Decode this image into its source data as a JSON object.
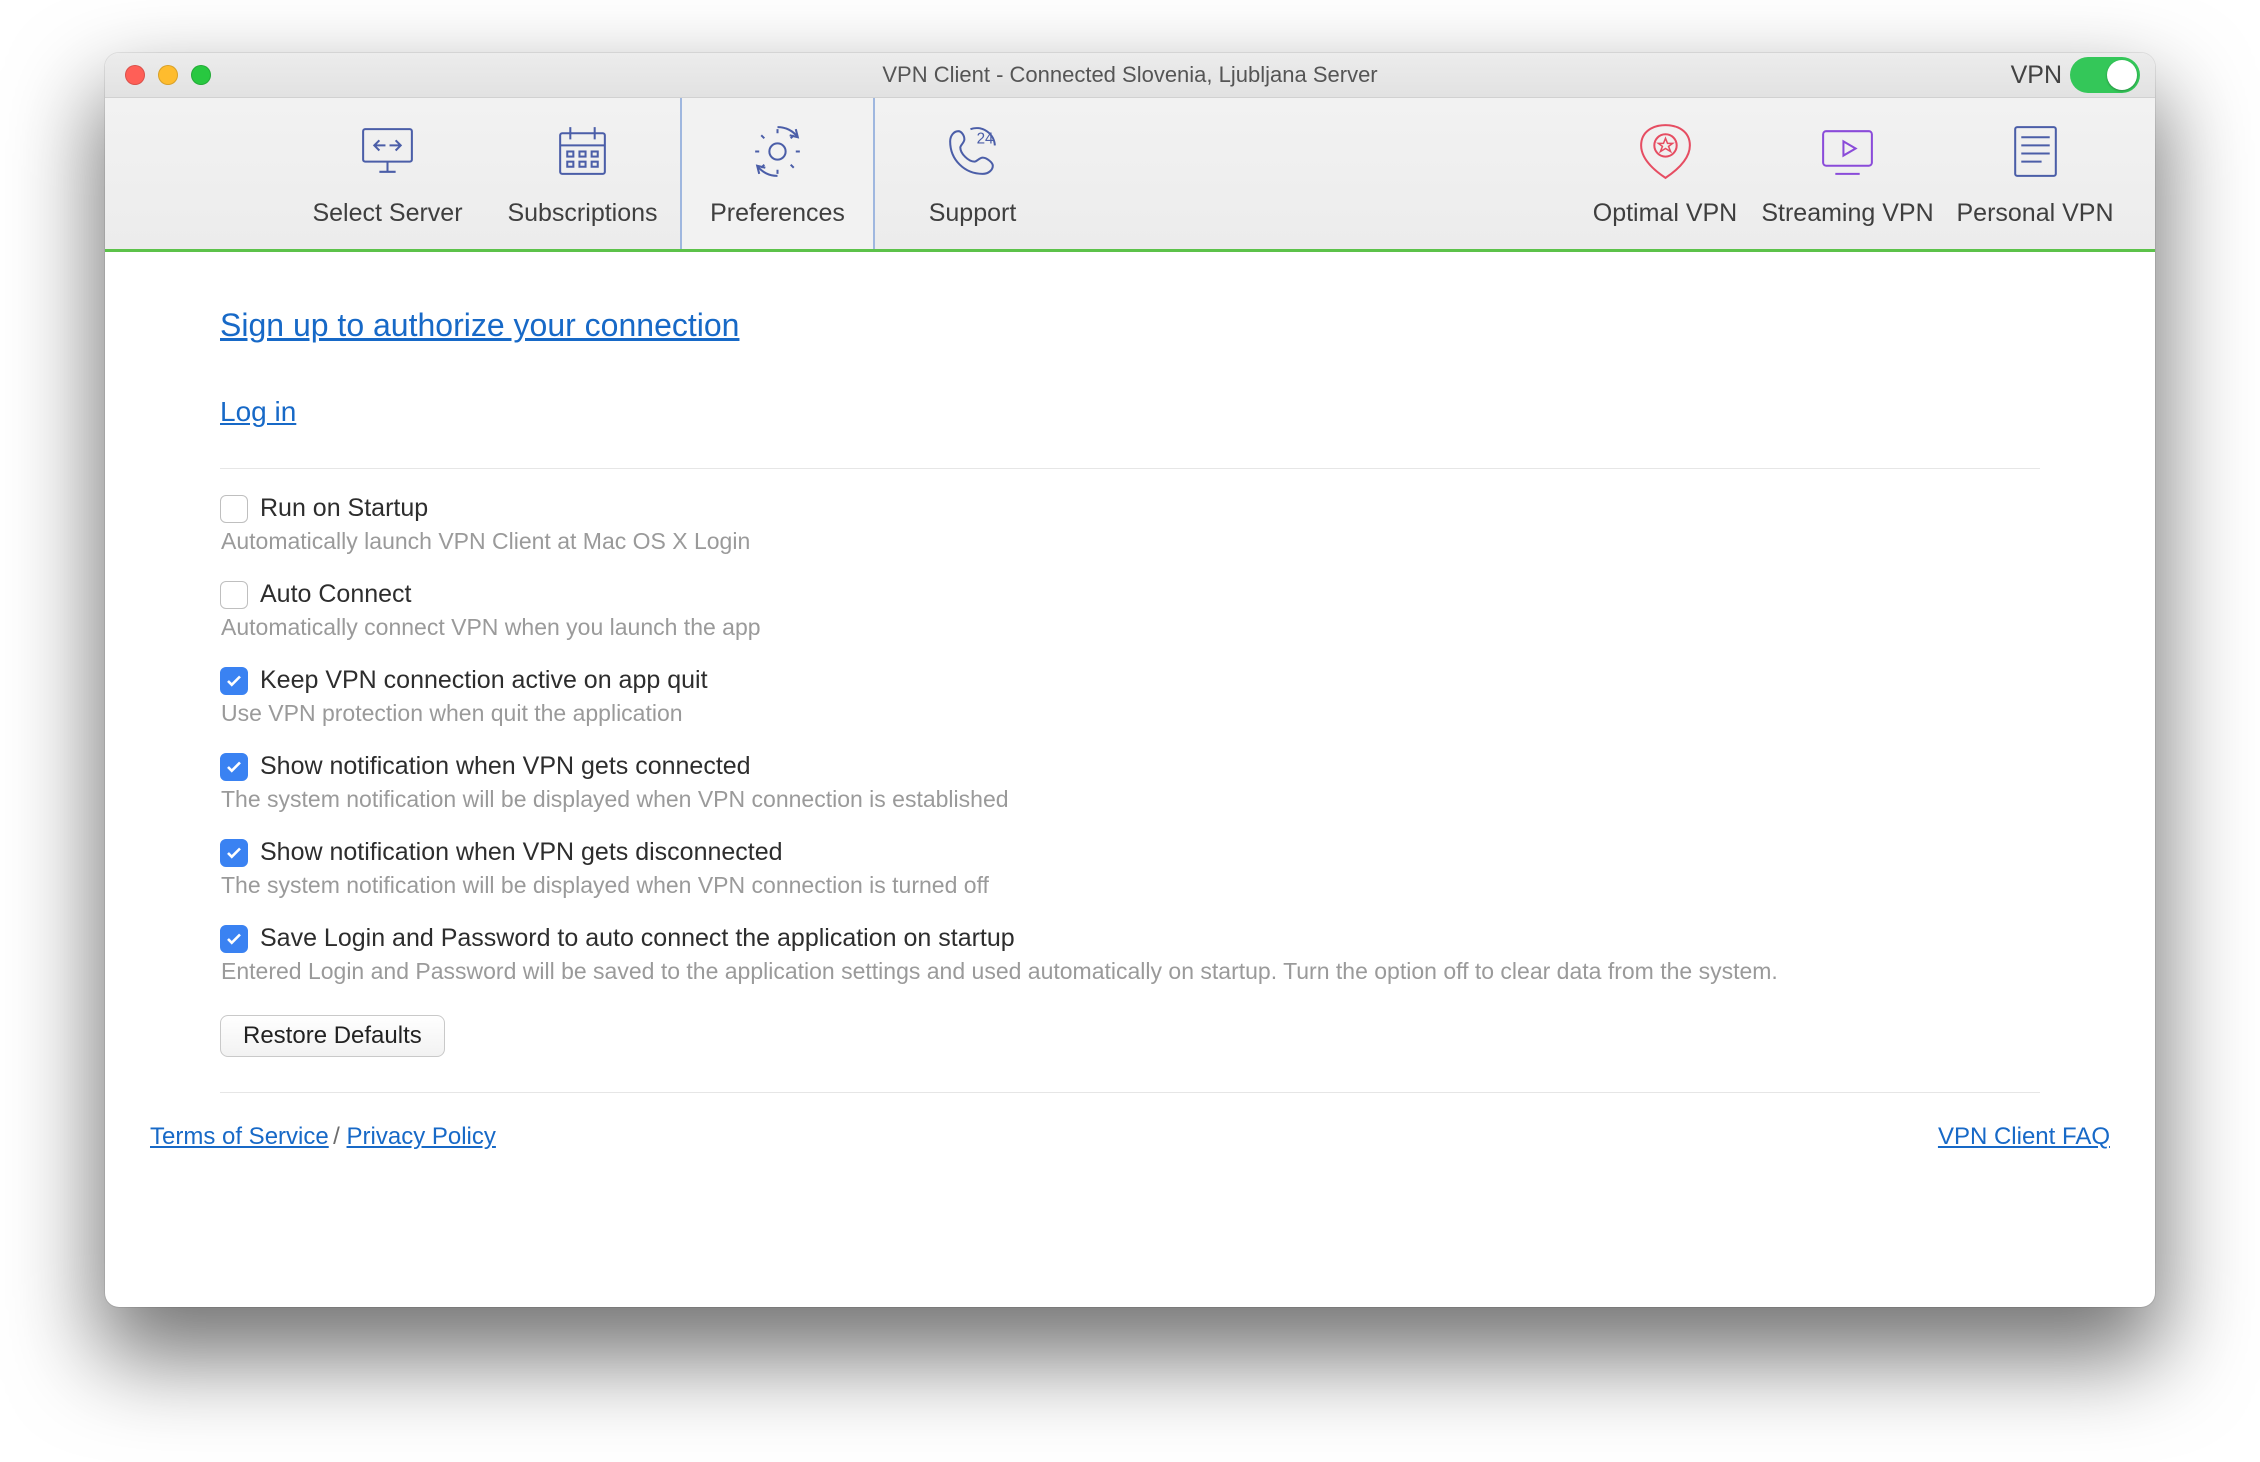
{
  "window": {
    "title": "VPN Client - Connected Slovenia, Ljubljana Server",
    "vpn_label": "VPN",
    "vpn_on": true
  },
  "toolbar": {
    "select_server": "Select Server",
    "subscriptions": "Subscriptions",
    "preferences": "Preferences",
    "support": "Support",
    "optimal": "Optimal VPN",
    "streaming": "Streaming VPN",
    "personal": "Personal VPN",
    "selected": "preferences"
  },
  "auth": {
    "signup": "Sign up to authorize your connection",
    "login": "Log in"
  },
  "options": [
    {
      "id": "run-startup",
      "label": "Run on Startup",
      "desc": "Automatically launch VPN Client at Mac OS X Login",
      "checked": false
    },
    {
      "id": "auto-connect",
      "label": "Auto Connect",
      "desc": "Automatically connect VPN when you launch the app",
      "checked": false
    },
    {
      "id": "keep-active",
      "label": "Keep VPN connection active on app quit",
      "desc": "Use VPN protection when quit the application",
      "checked": true
    },
    {
      "id": "notif-connected",
      "label": "Show notification when VPN gets connected",
      "desc": "The system notification will be displayed when VPN connection is established",
      "checked": true
    },
    {
      "id": "notif-disconnected",
      "label": "Show notification when VPN gets disconnected",
      "desc": "The system notification will be displayed when VPN connection is turned off",
      "checked": true
    },
    {
      "id": "save-login",
      "label": "Save Login and Password to auto connect the application on startup",
      "desc": "Entered Login and Password will be saved to the application settings and used automatically on startup. Turn the option off to clear data from the system.",
      "checked": true
    }
  ],
  "buttons": {
    "restore": "Restore Defaults"
  },
  "footer": {
    "tos": "Terms of Service",
    "sep": " / ",
    "privacy": "Privacy Policy",
    "faq": "VPN Client FAQ"
  }
}
